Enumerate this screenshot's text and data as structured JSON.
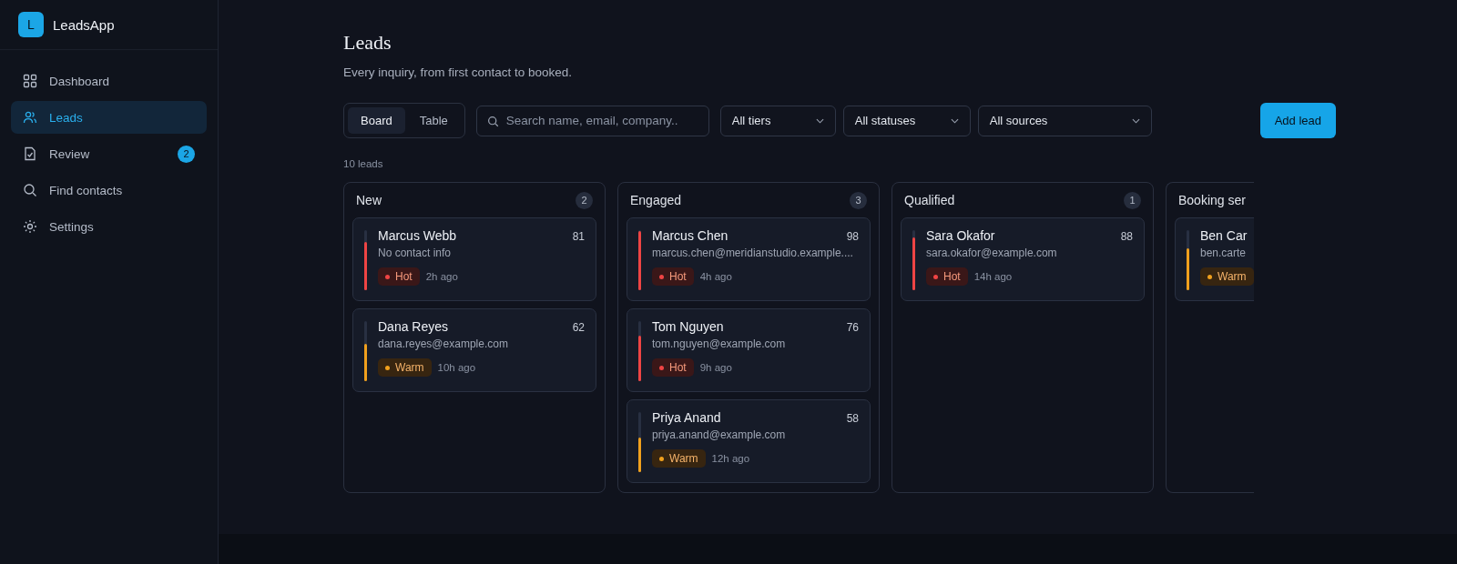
{
  "app": {
    "logo_letter": "L",
    "name": "LeadsApp"
  },
  "sidebar": {
    "items": [
      {
        "label": "Dashboard",
        "selected": false
      },
      {
        "label": "Leads",
        "selected": true
      },
      {
        "label": "Review",
        "selected": false,
        "badge": "2"
      },
      {
        "label": "Find contacts",
        "selected": false
      },
      {
        "label": "Settings",
        "selected": false
      }
    ]
  },
  "header": {
    "title": "Leads",
    "subtitle": "Every inquiry, from first contact to booked."
  },
  "view_toggle": [
    {
      "label": "Board",
      "selected": true
    },
    {
      "label": "Table",
      "selected": false
    }
  ],
  "search": {
    "placeholder": "Search name, email, company.."
  },
  "filters": [
    "All tiers",
    "All statuses",
    "All sources"
  ],
  "add_button": "Add lead",
  "count_label": "10 leads",
  "columns": [
    {
      "title": "New",
      "count": "2",
      "leads": [
        {
          "name": "Marcus Webb",
          "contact": "No contact info",
          "score": "81",
          "level": 0.81,
          "tier": "Hot",
          "kind": "hot",
          "time": "2h ago"
        },
        {
          "name": "Dana Reyes",
          "contact": "dana.reyes@example.com",
          "score": "62",
          "level": 0.62,
          "tier": "Warm",
          "kind": "warm",
          "time": "10h ago"
        }
      ]
    },
    {
      "title": "Engaged",
      "count": "3",
      "leads": [
        {
          "name": "Marcus Chen",
          "contact": "marcus.chen@meridianstudio.example....",
          "score": "98",
          "level": 0.98,
          "tier": "Hot",
          "kind": "hot",
          "time": "4h ago"
        },
        {
          "name": "Tom Nguyen",
          "contact": "tom.nguyen@example.com",
          "score": "76",
          "level": 0.76,
          "tier": "Hot",
          "kind": "hot",
          "time": "9h ago"
        },
        {
          "name": "Priya Anand",
          "contact": "priya.anand@example.com",
          "score": "58",
          "level": 0.58,
          "tier": "Warm",
          "kind": "warm",
          "time": "12h ago"
        }
      ]
    },
    {
      "title": "Qualified",
      "count": "1",
      "leads": [
        {
          "name": "Sara Okafor",
          "contact": "sara.okafor@example.com",
          "score": "88",
          "level": 0.88,
          "tier": "Hot",
          "kind": "hot",
          "time": "14h ago"
        }
      ]
    },
    {
      "title": "Booking ser",
      "leads": [
        {
          "name": "Ben Car",
          "contact": "ben.carte",
          "level": 0.7,
          "tier": "Warm",
          "kind": "warm"
        }
      ]
    }
  ]
}
